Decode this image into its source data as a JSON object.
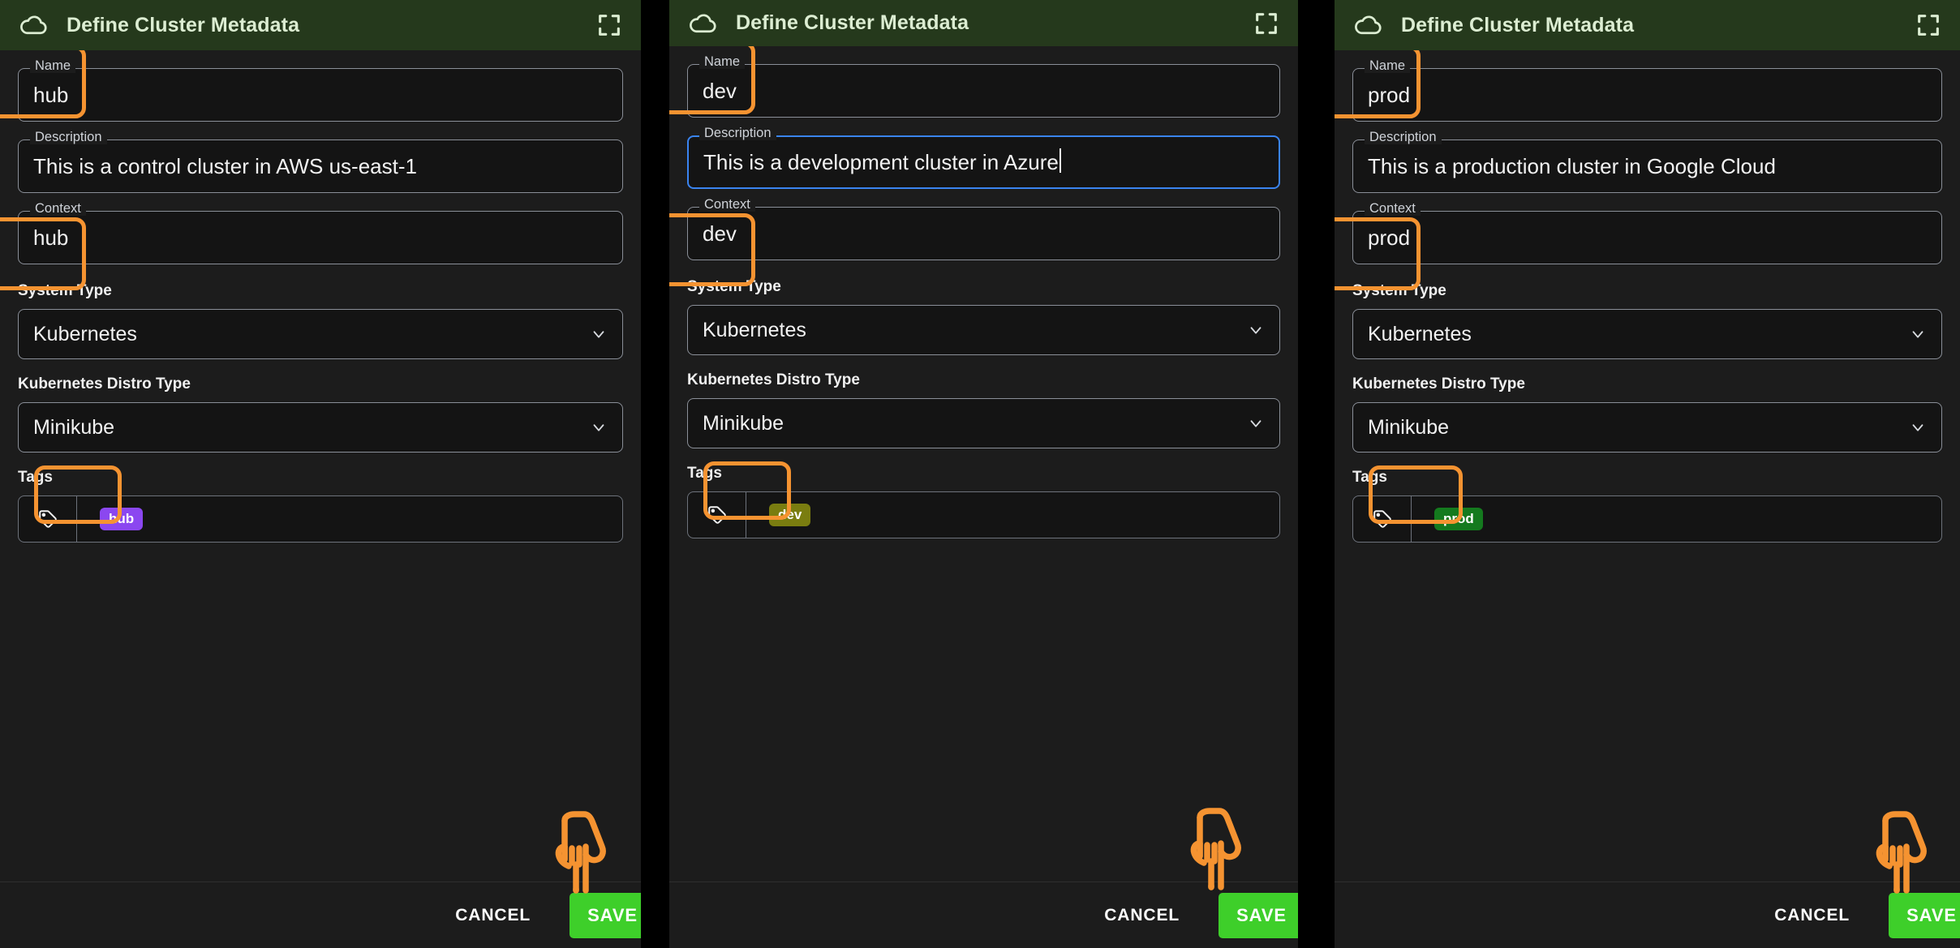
{
  "panels": [
    {
      "id": "hub",
      "header": {
        "title": "Define Cluster Metadata",
        "cloud_icon": "cloud-icon",
        "expand_icon": "expand-icon"
      },
      "fields": {
        "name": {
          "label": "Name",
          "value": "hub",
          "focused": false,
          "caret": false
        },
        "description": {
          "label": "Description",
          "value": "This is a control cluster in AWS us-east-1",
          "focused": false,
          "caret": false
        },
        "context": {
          "label": "Context",
          "value": "hub",
          "focused": false,
          "caret": false
        }
      },
      "selects": [
        {
          "label": "System Type",
          "value": "Kubernetes",
          "icon": "chevron-down-icon"
        },
        {
          "label": "Kubernetes Distro Type",
          "value": "Minikube",
          "icon": "chevron-down-icon"
        }
      ],
      "tags": {
        "label": "Tags",
        "icon": "tag-icon",
        "chips": [
          {
            "text": "hub",
            "color": "#8b47f0"
          }
        ]
      },
      "footer": {
        "cancel_label": "CANCEL",
        "save_label": "SAVE",
        "save_color": "#3ecf2a"
      },
      "annotations": [
        "name-field",
        "context-field",
        "tag-chip"
      ]
    },
    {
      "id": "dev",
      "header": {
        "title": "Define Cluster Metadata",
        "cloud_icon": "cloud-icon",
        "expand_icon": "expand-icon"
      },
      "fields": {
        "name": {
          "label": "Name",
          "value": "dev",
          "focused": false,
          "caret": false
        },
        "description": {
          "label": "Description",
          "value": "This is a development cluster in Azure",
          "focused": true,
          "caret": true
        },
        "context": {
          "label": "Context",
          "value": "dev",
          "focused": false,
          "caret": false
        }
      },
      "selects": [
        {
          "label": "System Type",
          "value": "Kubernetes",
          "icon": "chevron-down-icon"
        },
        {
          "label": "Kubernetes Distro Type",
          "value": "Minikube",
          "icon": "chevron-down-icon"
        }
      ],
      "tags": {
        "label": "Tags",
        "icon": "tag-icon",
        "chips": [
          {
            "text": "dev",
            "color": "#7a7d10"
          }
        ]
      },
      "footer": {
        "cancel_label": "CANCEL",
        "save_label": "SAVE",
        "save_color": "#3ecf2a"
      },
      "annotations": [
        "name-field",
        "context-field",
        "tag-chip"
      ]
    },
    {
      "id": "prod",
      "header": {
        "title": "Define Cluster Metadata",
        "cloud_icon": "cloud-icon",
        "expand_icon": "expand-icon"
      },
      "fields": {
        "name": {
          "label": "Name",
          "value": "prod",
          "focused": false,
          "caret": false
        },
        "description": {
          "label": "Description",
          "value": "This is a production cluster in Google Cloud",
          "focused": false,
          "caret": false
        },
        "context": {
          "label": "Context",
          "value": "prod",
          "focused": false,
          "caret": false
        }
      },
      "selects": [
        {
          "label": "System Type",
          "value": "Kubernetes",
          "icon": "chevron-down-icon"
        },
        {
          "label": "Kubernetes Distro Type",
          "value": "Minikube",
          "icon": "chevron-down-icon"
        }
      ],
      "tags": {
        "label": "Tags",
        "icon": "tag-icon",
        "chips": [
          {
            "text": "prod",
            "color": "#147a1e"
          }
        ]
      },
      "footer": {
        "cancel_label": "CANCEL",
        "save_label": "SAVE",
        "save_color": "#3ecf2a"
      },
      "annotations": [
        "name-field",
        "context-field",
        "tag-chip"
      ]
    }
  ],
  "theme": {
    "header_bg": "#25391c",
    "header_text": "#dcedd2",
    "body_bg": "#1c1c1c",
    "field_bg": "#141414",
    "field_border": "#8a8f98",
    "focus_border": "#3a84f0",
    "annotation_color": "#f59331",
    "save_green": "#3ecf2a",
    "page_bg": "#000000"
  },
  "cursor": {
    "icon": "pointing-hand-cursor",
    "color": "#f59331"
  }
}
